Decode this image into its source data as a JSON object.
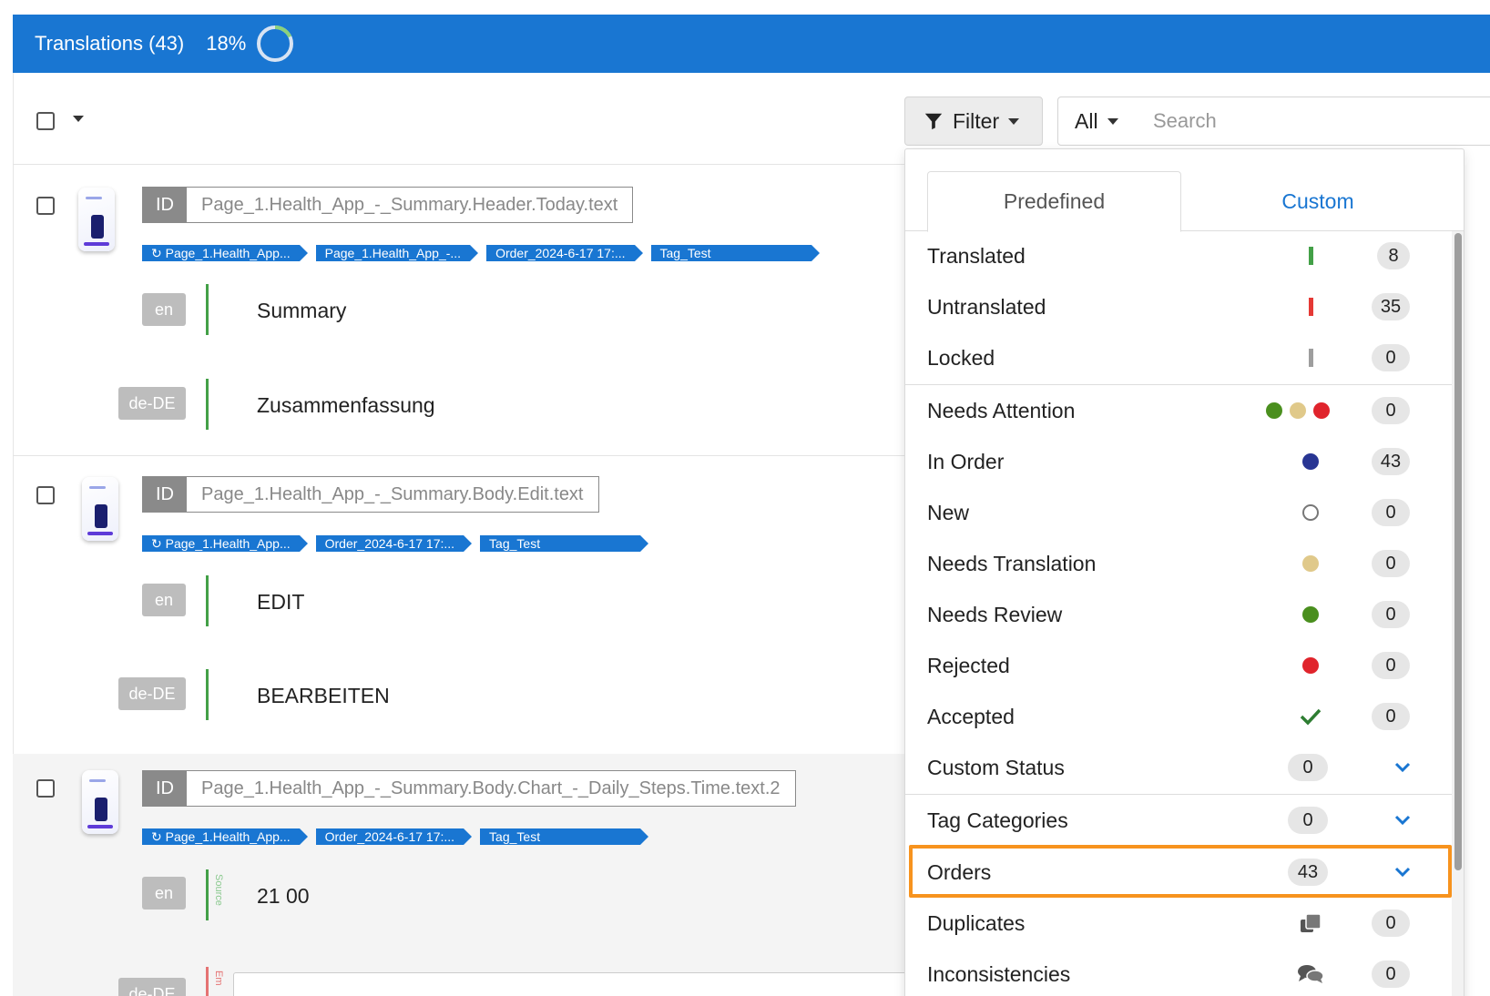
{
  "header": {
    "title": "Translations (43)",
    "progress_label": "18%",
    "progress_value": 0.18,
    "bg_color": "#1976d2"
  },
  "toolbar": {
    "filter_label": "Filter",
    "scope_label": "All",
    "search_placeholder": "Search"
  },
  "rows": [
    {
      "id": "Page_1.Health_App_-_Summary.Header.Today.text",
      "tags": [
        "Page_1.Health_App...",
        "Page_1.Health_App_-...",
        "Order_2024-6-17 17:...",
        "Tag_Test"
      ],
      "source_lang": "en",
      "source_text": "Summary",
      "target_lang": "de-DE",
      "target_text": "Zusammenfassung"
    },
    {
      "id": "Page_1.Health_App_-_Summary.Body.Edit.text",
      "tags": [
        "Page_1.Health_App...",
        "Order_2024-6-17 17:...",
        "Tag_Test"
      ],
      "source_lang": "en",
      "source_text": "EDIT",
      "target_lang": "de-DE",
      "target_text": "BEARBEITEN"
    },
    {
      "id": "Page_1.Health_App_-_Summary.Body.Chart_-_Daily_Steps.Time.text.2",
      "tags": [
        "Page_1.Health_App...",
        "Order_2024-6-17 17:...",
        "Tag_Test"
      ],
      "source_lang": "en",
      "source_text": "21 00",
      "source_side_label": "Source",
      "target_lang": "de-DE",
      "target_side_label": "Em"
    }
  ],
  "filter_panel": {
    "tabs": [
      "Predefined",
      "Custom"
    ],
    "items": {
      "translated": {
        "label": "Translated",
        "count": "8",
        "color": "#43a047"
      },
      "untranslated": {
        "label": "Untranslated",
        "count": "35",
        "color": "#e53935"
      },
      "locked": {
        "label": "Locked",
        "count": "0",
        "color": "#9e9e9e"
      },
      "needs_attention": {
        "label": "Needs Attention",
        "count": "0"
      },
      "in_order": {
        "label": "In Order",
        "count": "43",
        "color": "#283593"
      },
      "new": {
        "label": "New",
        "count": "0"
      },
      "needs_translation": {
        "label": "Needs Translation",
        "count": "0",
        "color": "#e0c98a"
      },
      "needs_review": {
        "label": "Needs Review",
        "count": "0",
        "color": "#4a8f1e"
      },
      "rejected": {
        "label": "Rejected",
        "count": "0",
        "color": "#e0242c"
      },
      "accepted": {
        "label": "Accepted",
        "count": "0",
        "color": "#2e7d32"
      },
      "custom_status": {
        "label": "Custom Status",
        "count": "0"
      },
      "tag_categories": {
        "label": "Tag Categories",
        "count": "0"
      },
      "orders": {
        "label": "Orders",
        "count": "43"
      },
      "duplicates": {
        "label": "Duplicates",
        "count": "0"
      },
      "inconsistencies": {
        "label": "Inconsistencies",
        "count": "0"
      }
    },
    "highlight_color": "#f7931e"
  }
}
